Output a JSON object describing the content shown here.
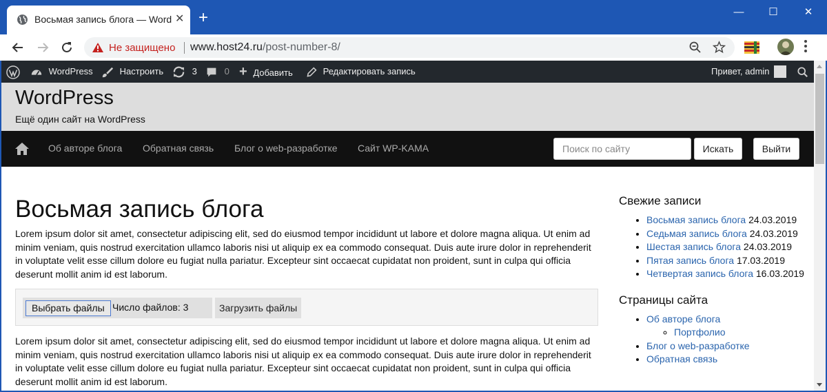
{
  "browser": {
    "tab_title": "Восьмая запись блога — WordPress",
    "security_label": "Не защищено",
    "url_host": "www.host24.ru",
    "url_path": "/post-number-8/"
  },
  "adminbar": {
    "wordpress": "WordPress",
    "customize": "Настроить",
    "updates": "3",
    "comments": "0",
    "add_new": "Добавить",
    "edit_post": "Редактировать запись",
    "greeting": "Привет, admin"
  },
  "site": {
    "title": "WordPress",
    "description": "Ещё один сайт на WordPress"
  },
  "nav": {
    "items": [
      {
        "label": "Об авторе блога"
      },
      {
        "label": "Обратная связь"
      },
      {
        "label": "Блог о web-разработке"
      },
      {
        "label": "Сайт WP-KAMA"
      }
    ],
    "search_placeholder": "Поиск по сайту",
    "search_button": "Искать",
    "logout_button": "Выйти"
  },
  "post": {
    "title": "Восьмая запись блога",
    "paragraph1": "Lorem ipsum dolor sit amet, consectetur adipiscing elit, sed do eiusmod tempor incididunt ut labore et dolore magna aliqua. Ut enim ad minim veniam, quis nostrud exercitation ullamco laboris nisi ut aliquip ex ea commodo consequat. Duis aute irure dolor in reprehenderit in voluptate velit esse cillum dolore eu fugiat nulla pariatur. Excepteur sint occaecat cupidatat non proident, sunt in culpa qui officia deserunt mollit anim id est laborum.",
    "paragraph2": "Lorem ipsum dolor sit amet, consectetur adipiscing elit, sed do eiusmod tempor incididunt ut labore et dolore magna aliqua. Ut enim ad minim veniam, quis nostrud exercitation ullamco laboris nisi ut aliquip ex ea commodo consequat. Duis aute irure dolor in reprehenderit in voluptate velit esse cillum dolore eu fugiat nulla pariatur. Excepteur sint occaecat cupidatat non proident, sunt in culpa qui officia deserunt mollit anim id est laborum."
  },
  "upload": {
    "choose_files": "Выбрать файлы",
    "file_count": "Число файлов: 3",
    "upload_button": "Загрузить файлы"
  },
  "sidebar": {
    "recent_title": "Свежие записи",
    "recent_posts": [
      {
        "title": "Восьмая запись блога",
        "date": "24.03.2019"
      },
      {
        "title": "Седьмая запись блога",
        "date": "24.03.2019"
      },
      {
        "title": "Шестая запись блога",
        "date": "24.03.2019"
      },
      {
        "title": "Пятая запись блога",
        "date": "17.03.2019"
      },
      {
        "title": "Четвертая запись блога",
        "date": "16.03.2019"
      }
    ],
    "pages_title": "Страницы сайта",
    "pages": {
      "about": "Об авторе блога",
      "portfolio": "Портфолио",
      "blog": "Блог о web-разработке",
      "contact": "Обратная связь"
    }
  }
}
